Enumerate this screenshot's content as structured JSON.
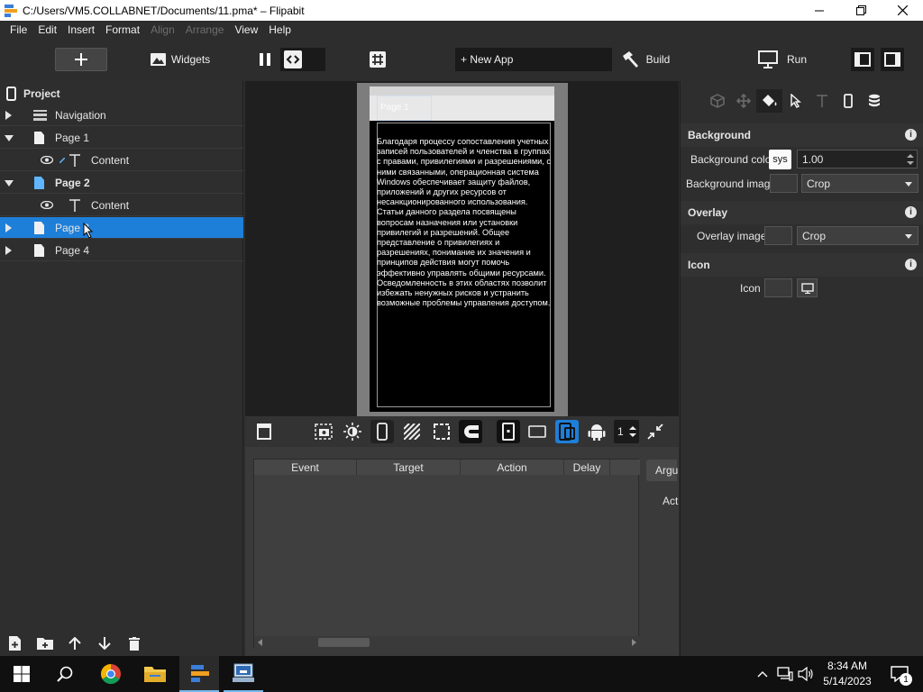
{
  "window": {
    "title": "C:/Users/VM5.COLLABNET/Documents/11.pma* – Flipabit"
  },
  "menu": [
    "File",
    "Edit",
    "Insert",
    "Format",
    "Align",
    "Arrange",
    "View",
    "Help"
  ],
  "menu_disabled": [
    "Align",
    "Arrange"
  ],
  "toolbar": {
    "widgets_label": "Widgets",
    "new_app_label": "+ New App",
    "build_label": "Build",
    "run_label": "Run"
  },
  "project": {
    "title": "Project",
    "items": [
      {
        "label": "Navigation",
        "icon": "navigation-icon",
        "expanded": false,
        "level": 0
      },
      {
        "label": "Page 1",
        "icon": "page-icon",
        "expanded": true,
        "level": 0
      },
      {
        "label": "Content",
        "icon": "text-icon",
        "level": 1
      },
      {
        "label": "Page 2",
        "icon": "page-icon",
        "expanded": true,
        "level": 0,
        "bold": true
      },
      {
        "label": "Content",
        "icon": "text-icon",
        "level": 1
      },
      {
        "label": "Page 3",
        "icon": "page-icon",
        "expanded": false,
        "level": 0,
        "selected": true
      },
      {
        "label": "Page 4",
        "icon": "page-icon",
        "expanded": false,
        "level": 0
      }
    ]
  },
  "preview": {
    "tab_label": "Page 1",
    "content_text": "Благодаря процессу сопоставления учетных записей пользователей и членства в группах с правами, привилегиями и разрешениями, с ними связанными, операционная система Windows обеспечивает защиту файлов, приложений и других ресурсов от несанкционированного использования. Статьи данного раздела посвящены вопросам назначения или установки привилегий и разрешений. Общее представление о привилегиях и разрешениях, понимание их значения и принципов действия могут помочь эффективно управлять общими ресурсами. Осведомленность в этих областях позволит избежать ненужных рисков и устранить возможные проблемы управления доступом."
  },
  "canvas_tools": {
    "zoom_value": "1"
  },
  "events": {
    "columns": [
      "Event",
      "Target",
      "Action",
      "Delay"
    ],
    "arguments_tab": "Argu",
    "action_label": "Act"
  },
  "properties": {
    "background": {
      "title": "Background",
      "color_label": "Background color",
      "color_button": "sys",
      "opacity_value": "1.00",
      "image_label": "Background image",
      "image_mode": "Crop"
    },
    "overlay": {
      "title": "Overlay",
      "image_label": "Overlay image",
      "image_mode": "Crop"
    },
    "icon": {
      "title": "Icon",
      "label": "Icon"
    }
  },
  "taskbar": {
    "time": "8:34 AM",
    "date": "5/14/2023",
    "notification_count": "1"
  },
  "colors": {
    "accent": "#1e7fd9",
    "panel": "#2e2e2e",
    "selected_page_icon": "#5fb6ff"
  }
}
